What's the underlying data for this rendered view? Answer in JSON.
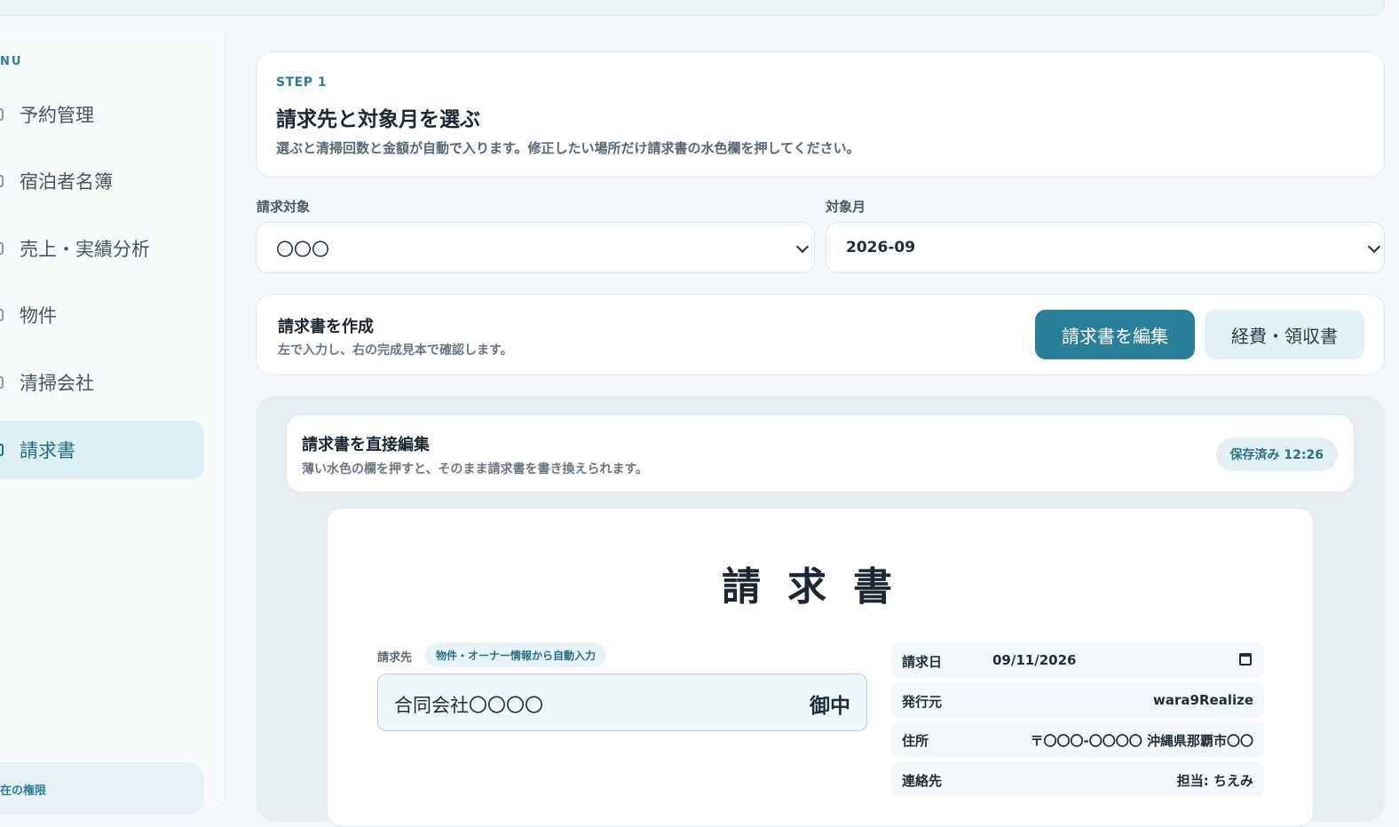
{
  "topbar": {},
  "sidebar": {
    "heading": "NU",
    "items": [
      {
        "label": "予約管理",
        "icon": "calendar-icon"
      },
      {
        "label": "宿泊者名簿",
        "icon": "person-icon"
      },
      {
        "label": "売上・実績分析",
        "icon": "chart-icon"
      },
      {
        "label": "物件",
        "icon": "building-icon"
      },
      {
        "label": "清掃会社",
        "icon": "broom-icon"
      },
      {
        "label": "請求書",
        "icon": "invoice-icon",
        "active": true
      }
    ],
    "permissions_label": "在の権限"
  },
  "step": {
    "label": "STEP 1",
    "title": "請求先と対象月を選ぶ",
    "description": "選ぶと清掃回数と金額が自動で入ります。修正したい場所だけ請求書の水色欄を押してください。"
  },
  "selectors": {
    "target_label": "請求対象",
    "target_value": "〇〇〇",
    "month_label": "対象月",
    "month_value": "2026-09"
  },
  "create": {
    "title": "請求書を作成",
    "description": "左で入力し、右の完成見本で確認します。",
    "edit_button": "請求書を編集",
    "expense_button": "経費・領収書"
  },
  "direct_edit": {
    "title": "請求書を直接編集",
    "description": "薄い水色の欄を押すと、そのまま請求書を書き換えられます。",
    "saved_badge": "保存済み 12:26"
  },
  "invoice": {
    "title": "請求書",
    "billto_label": "請求先",
    "auto_chip": "物件・オーナー情報から自動入力",
    "billto_name": "合同会社〇〇〇〇",
    "billto_suffix": "御中",
    "rows": {
      "date_key": "請求日",
      "date_value": "09/11/2026",
      "issuer_key": "発行元",
      "issuer_value": "wara9Realize",
      "address_key": "住所",
      "address_value": "〒〇〇〇-〇〇〇〇 沖縄県那覇市〇〇",
      "contact_key": "連絡先",
      "contact_value": "担当: ちえみ"
    }
  },
  "colors": {
    "accent": "#2b7f98",
    "accent_light": "#e4f1f5",
    "background": "#f4f8fa"
  }
}
